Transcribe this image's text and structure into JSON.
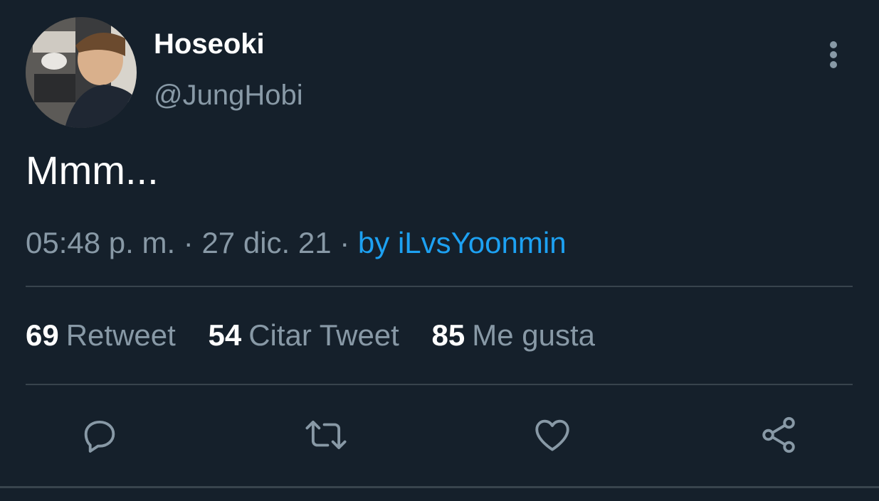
{
  "author": {
    "display_name": "Hoseoki",
    "handle": "@JungHobi"
  },
  "tweet": {
    "text": "Mmm...",
    "time": "05:48 p. m.",
    "separator1": " · ",
    "date": "27 dic. 21",
    "separator2": " · ",
    "source": "by iLvsYoonmin"
  },
  "stats": [
    {
      "count": "69",
      "label": "Retweet"
    },
    {
      "count": "54",
      "label": "Citar Tweet"
    },
    {
      "count": "85",
      "label": "Me gusta"
    }
  ],
  "icons": {
    "more": "more-vertical-icon",
    "reply": "reply-icon",
    "retweet": "retweet-icon",
    "like": "heart-icon",
    "share": "share-icon"
  },
  "colors": {
    "background": "#15202b",
    "text_primary": "#ffffff",
    "text_secondary": "#8899a6",
    "link": "#1da1f2",
    "divider": "#38444d"
  }
}
